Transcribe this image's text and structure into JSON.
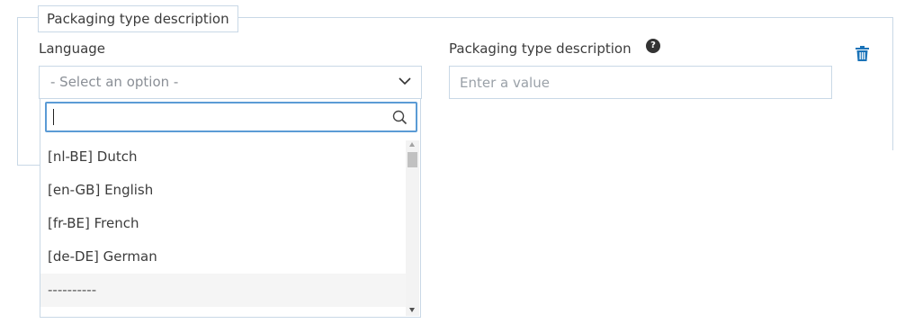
{
  "fieldset": {
    "legend": "Packaging type description"
  },
  "language": {
    "label": "Language",
    "placeholder": "- Select an option -",
    "search_value": "",
    "options": [
      "[nl-BE] Dutch",
      "[en-GB] English",
      "[fr-BE] French",
      "[de-DE] German",
      "----------"
    ]
  },
  "description": {
    "label": "Packaging type description",
    "help_icon": "question-circle-icon",
    "placeholder": "Enter a value",
    "value": ""
  },
  "colors": {
    "accent": "#1a73b8",
    "border": "#c9d8e6",
    "focus": "#5b9bd5"
  },
  "icons": {
    "delete": "trash-icon",
    "chevron": "chevron-down-icon",
    "search": "search-icon"
  }
}
